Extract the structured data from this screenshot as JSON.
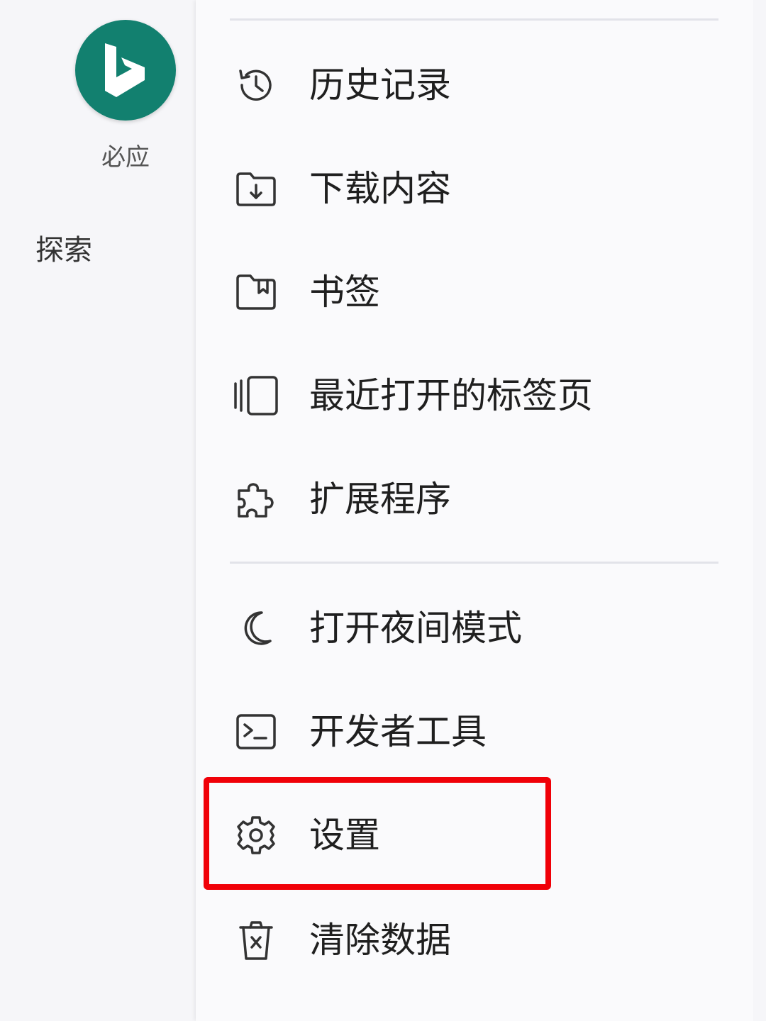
{
  "sidebar": {
    "app_name": "必应",
    "explore_label": "探索",
    "logo_icon": "bing-logo-icon",
    "logo_color": "#12806f"
  },
  "menu": {
    "items": [
      {
        "label": "历史记录",
        "icon": "history-icon"
      },
      {
        "label": "下载内容",
        "icon": "download-folder-icon"
      },
      {
        "label": "书签",
        "icon": "bookmark-icon"
      },
      {
        "label": "最近打开的标签页",
        "icon": "recent-tabs-icon"
      },
      {
        "label": "扩展程序",
        "icon": "extension-puzzle-icon"
      },
      {
        "label": "打开夜间模式",
        "icon": "moon-icon"
      },
      {
        "label": "开发者工具",
        "icon": "terminal-icon"
      },
      {
        "label": "设置",
        "icon": "gear-icon",
        "highlighted": true
      },
      {
        "label": "清除数据",
        "icon": "trash-icon"
      }
    ],
    "highlight_color": "#f00008"
  }
}
